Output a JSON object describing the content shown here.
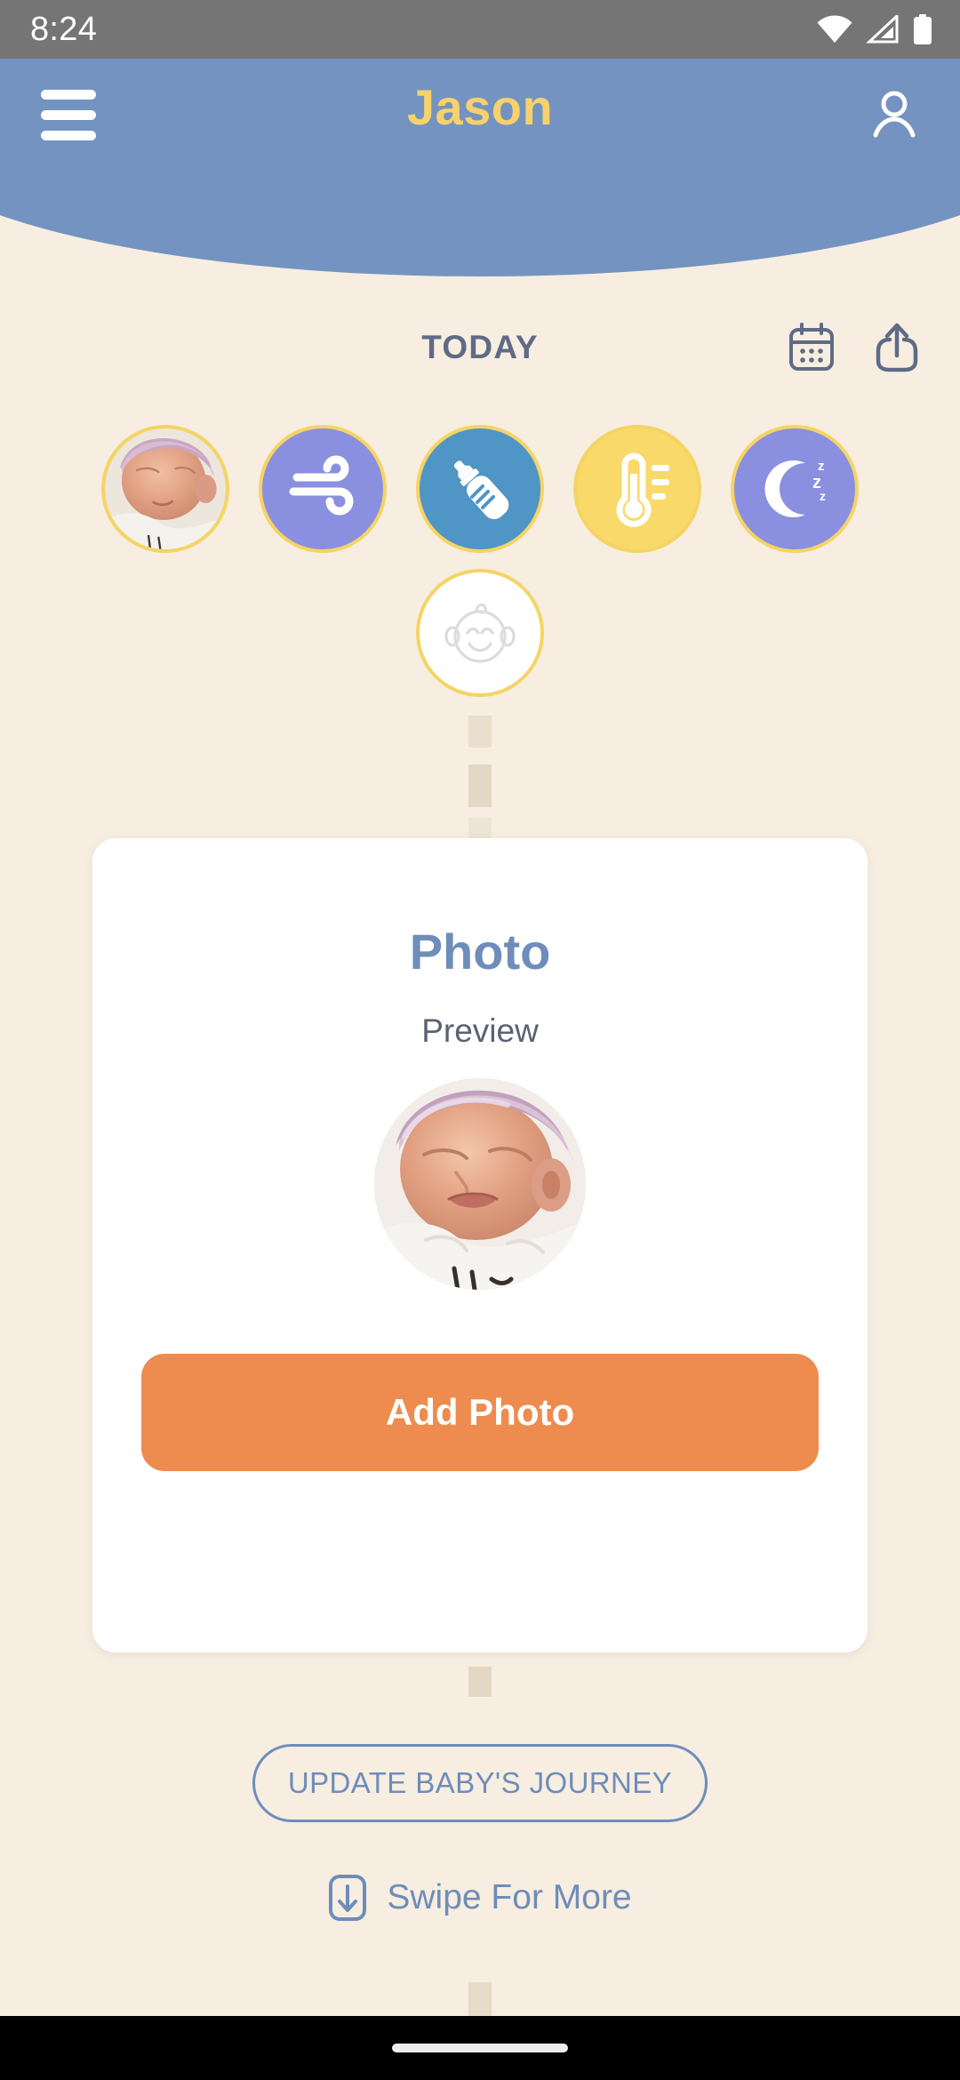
{
  "status_bar": {
    "time": "8:24",
    "icons": [
      "wifi-icon",
      "cellular-signal-icon",
      "battery-icon"
    ]
  },
  "header": {
    "menu_icon": "hamburger-menu-icon",
    "title": "Jason",
    "profile_icon": "account-person-icon",
    "background_color": "#7593C0",
    "title_color": "#F7D16B"
  },
  "today_row": {
    "label": "TODAY",
    "calendar_icon": "calendar-icon",
    "share_icon": "share-upload-icon",
    "label_color": "#5F6B86"
  },
  "tracker_circles": [
    {
      "name": "baby-photo",
      "icon": "baby-photo-avatar",
      "background": "#E7CFC2",
      "border": "#F5D464"
    },
    {
      "name": "diaper-air",
      "icon": "wind-icon",
      "background": "#8A8FE0",
      "border": "#F5D464"
    },
    {
      "name": "feeding",
      "icon": "baby-bottle-icon",
      "background": "#4F95C6",
      "border": "#F5D464"
    },
    {
      "name": "temperature",
      "icon": "thermometer-icon",
      "background": "#F8D96A",
      "border": "#F5D464"
    },
    {
      "name": "sleep",
      "icon": "moon-zzz-icon",
      "background": "#8A8FE0",
      "border": "#F5D464"
    }
  ],
  "tracker_circle_second_row": [
    {
      "name": "baby-face",
      "icon": "baby-face-icon",
      "background": "#FFFFFF",
      "border": "#F5D464"
    }
  ],
  "card": {
    "title": "Photo",
    "subtitle": "Preview",
    "photo_alt": "sleeping-newborn-in-knit-hat",
    "button_label": "Add Photo",
    "title_color": "#6E8DBA",
    "button_color": "#EE8B4E"
  },
  "journey_button": {
    "label": "UPDATE BABY'S JOURNEY",
    "color": "#6E8DBA"
  },
  "swipe": {
    "icon": "download-arrow-box-icon",
    "label": "Swipe For More",
    "color": "#6E8DBA"
  },
  "nav_bar": {
    "gesture_pill": "home-gesture-indicator"
  },
  "theme": {
    "page_background": "#F7EEE1",
    "accent_blue": "#7593C0",
    "accent_yellow": "#F5D464",
    "accent_orange": "#EE8B4E"
  }
}
